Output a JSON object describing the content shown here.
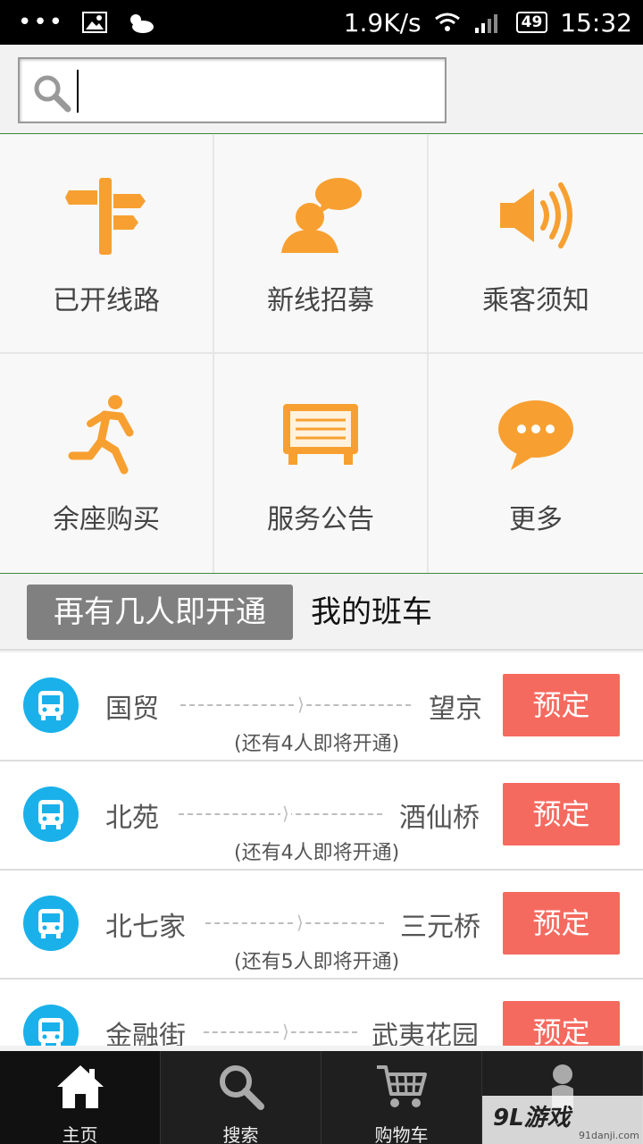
{
  "status_bar": {
    "dots": "•••",
    "net_speed": "1.9K/s",
    "battery": "49",
    "time": "15:32"
  },
  "search": {
    "value": "",
    "placeholder": ""
  },
  "menu": [
    {
      "label": "已开线路",
      "icon": "signpost-icon"
    },
    {
      "label": "新线招募",
      "icon": "person-speech-icon"
    },
    {
      "label": "乘客须知",
      "icon": "speaker-icon"
    },
    {
      "label": "余座购买",
      "icon": "running-man-icon"
    },
    {
      "label": "服务公告",
      "icon": "notice-board-icon"
    },
    {
      "label": "更多",
      "icon": "more-chat-icon"
    }
  ],
  "tabs": {
    "active": "再有几人即开通",
    "other": "我的班车"
  },
  "routes": [
    {
      "from": "国贸",
      "to": "望京",
      "note": "(还有4人即将开通)",
      "button": "预定"
    },
    {
      "from": "北苑",
      "to": "酒仙桥",
      "note": "(还有4人即将开通)",
      "button": "预定"
    },
    {
      "from": "北七家",
      "to": "三元桥",
      "note": "(还有5人即将开通)",
      "button": "预定"
    },
    {
      "from": "金融街",
      "to": "武夷花园",
      "note": "",
      "button": "预定"
    }
  ],
  "bottom_nav": [
    {
      "label": "主页",
      "icon": "home-icon"
    },
    {
      "label": "搜索",
      "icon": "search-icon"
    },
    {
      "label": "购物车",
      "icon": "cart-icon"
    },
    {
      "label": "",
      "icon": "user-icon"
    }
  ],
  "watermark": {
    "main": "9L游戏",
    "sub": "91danji.com"
  },
  "colors": {
    "accent_orange": "#f7a031",
    "book_button": "#f56a5f",
    "bus_icon": "#1ab1ea",
    "active_tab": "#808080"
  }
}
